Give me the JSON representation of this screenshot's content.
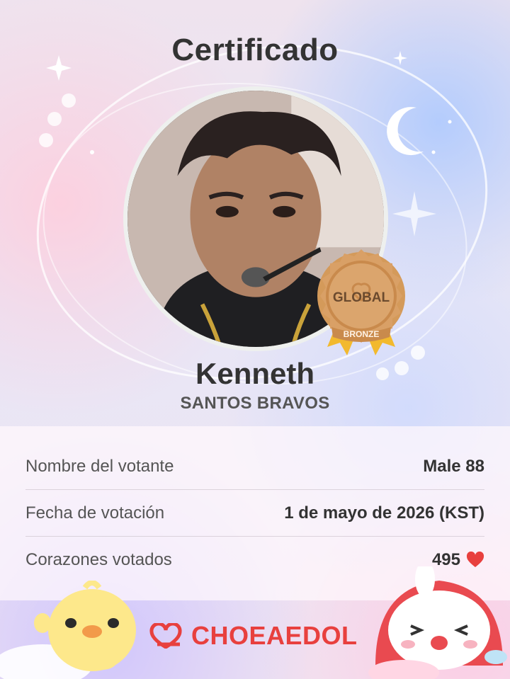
{
  "certificate": {
    "title": "Certificado",
    "artist_name": "Kenneth",
    "group_name": "SANTOS BRAVOS"
  },
  "badge": {
    "top_text": "GLOBAL",
    "bottom_text": "BRONZE",
    "color": "#d49a5a"
  },
  "info": {
    "rows": [
      {
        "label": "Nombre del votante",
        "value": "Male 88"
      },
      {
        "label": "Fecha de votación",
        "value": "1 de mayo de 2026 (KST)"
      },
      {
        "label": "Corazones votados",
        "value": "495"
      }
    ],
    "heart_icon": "heart-icon",
    "heart_color": "#e8403e"
  },
  "footer": {
    "brand": "CHOEAEDOL",
    "brand_color": "#e8403e"
  }
}
